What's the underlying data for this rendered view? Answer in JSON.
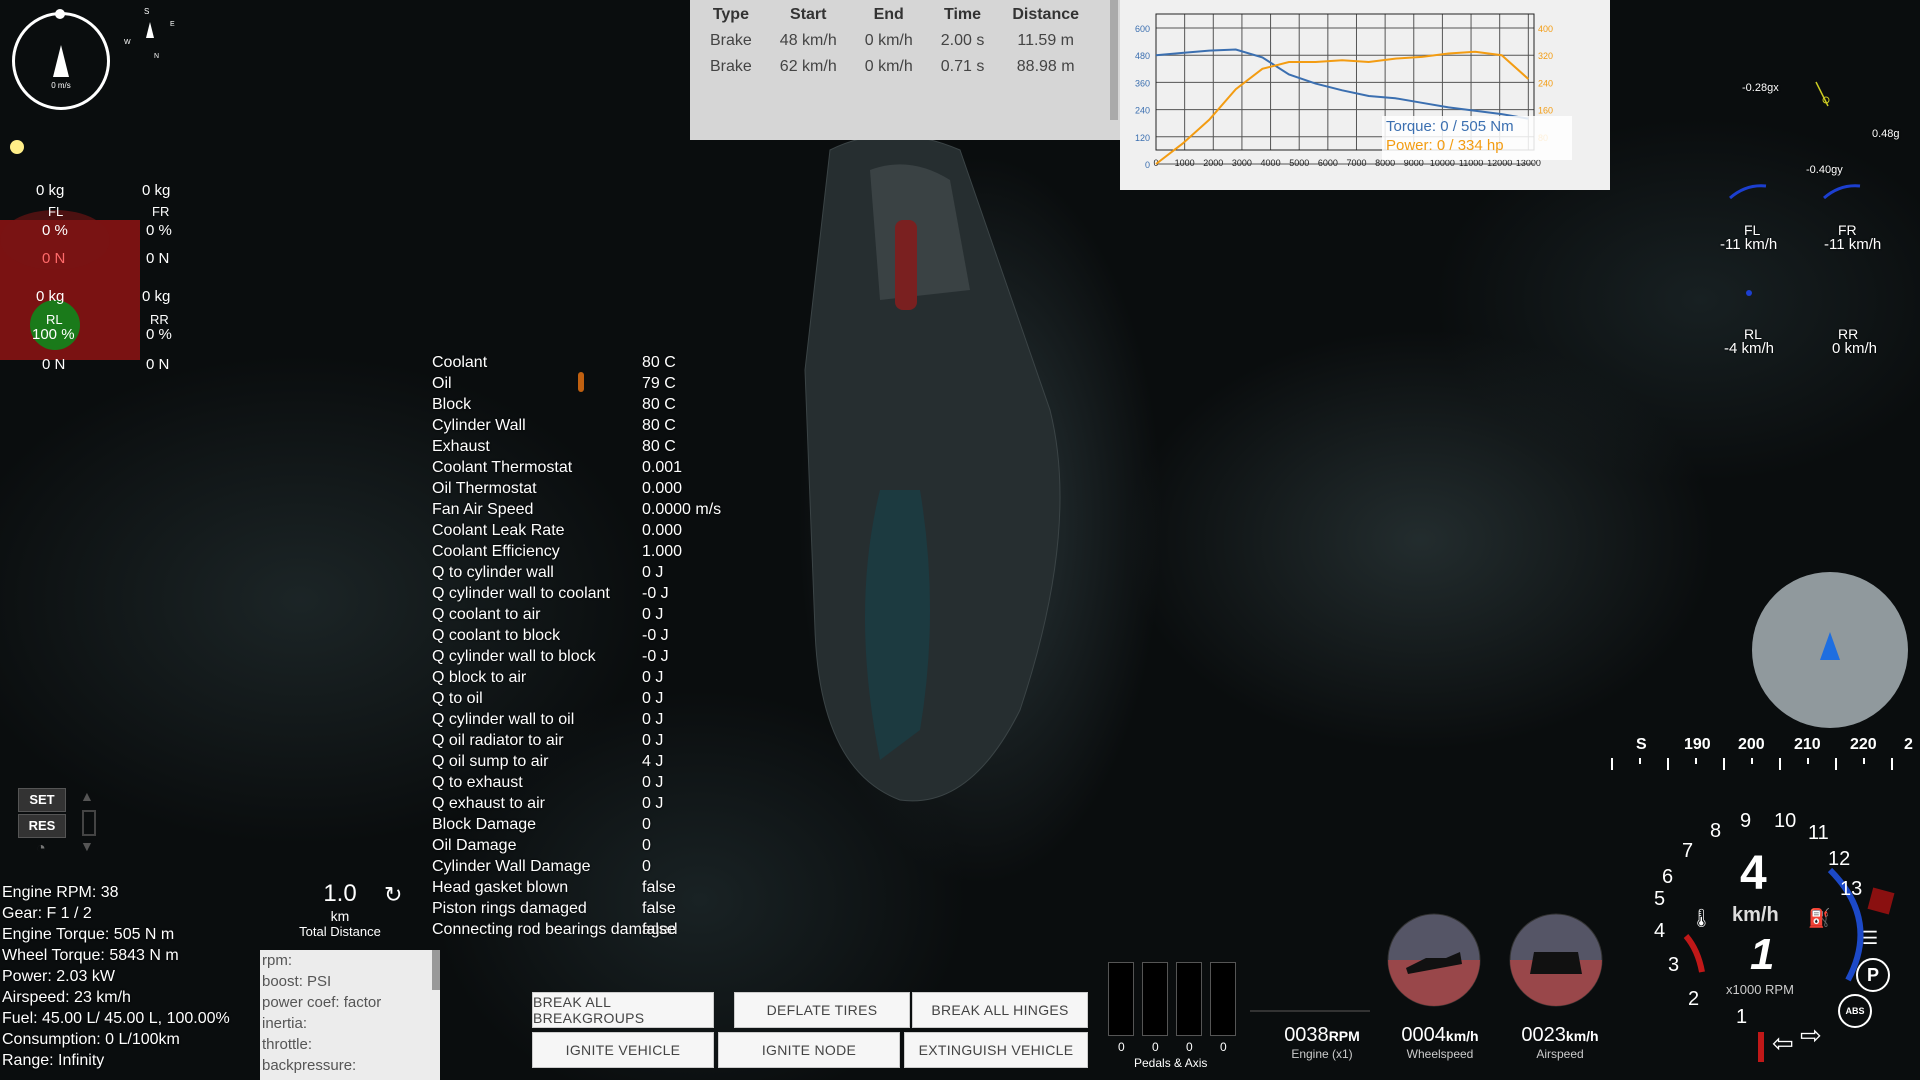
{
  "compass": {
    "speed": "0 m/s",
    "dirs": [
      "S",
      "E",
      "W",
      "N"
    ]
  },
  "tires_left": [
    {
      "mass": "0 kg",
      "label": "FL",
      "pct": "0 %",
      "force": "0 N"
    },
    {
      "mass": "0 kg",
      "label": "FR",
      "pct": "0 %",
      "force": "0 N"
    },
    {
      "mass": "0 kg",
      "label": "RL",
      "pct": "100 %",
      "force": "0 N"
    },
    {
      "mass": "0 kg",
      "label": "RR",
      "pct": "0 %",
      "force": "0 N"
    }
  ],
  "dyno_table": {
    "headers": [
      "Type",
      "Start",
      "End",
      "Time",
      "Distance"
    ],
    "rows": [
      [
        "Brake",
        "48 km/h",
        "0 km/h",
        "2.00 s",
        "11.59 m"
      ],
      [
        "Brake",
        "62 km/h",
        "0 km/h",
        "0.71 s",
        "88.98 m"
      ]
    ]
  },
  "chart_data": {
    "type": "line",
    "x": [
      0,
      1000,
      2000,
      3000,
      4000,
      5000,
      6000,
      7000,
      8000,
      9000,
      10000,
      11000,
      12000,
      13000
    ],
    "xticks": [
      "0",
      "1000",
      "2000",
      "3000",
      "4000",
      "5000",
      "6000",
      "7000",
      "8000",
      "9000",
      "10000",
      "11000",
      "12000",
      "13000"
    ],
    "yleft_ticks": [
      "0",
      "120",
      "240",
      "360",
      "480",
      "600"
    ],
    "yright_ticks": [
      "80",
      "160",
      "240",
      "320",
      "400"
    ],
    "ylim_left": [
      0,
      600
    ],
    "ylim_right": [
      0,
      400
    ],
    "series": [
      {
        "name": "Torque",
        "axis": "left",
        "color": "#3b6fb0",
        "values": [
          480,
          490,
          500,
          505,
          470,
          395,
          355,
          325,
          300,
          290,
          270,
          250,
          235,
          220,
          200
        ]
      },
      {
        "name": "Power",
        "axis": "right",
        "color": "#f39c12",
        "values": [
          0,
          60,
          130,
          220,
          280,
          300,
          300,
          305,
          300,
          310,
          315,
          325,
          330,
          320,
          250
        ]
      }
    ],
    "legend": [
      {
        "label": "Torque: 0 / 505 Nm",
        "color": "#3b6fb0"
      },
      {
        "label": "Power: 0 / 334 hp",
        "color": "#f39c12"
      }
    ],
    "legend_position": "bottom-right"
  },
  "thermo": [
    [
      "Coolant",
      "80 C"
    ],
    [
      "Oil",
      "79 C"
    ],
    [
      "Block",
      "80 C"
    ],
    [
      "Cylinder Wall",
      "80 C"
    ],
    [
      "Exhaust",
      "80 C"
    ],
    [
      "Coolant Thermostat",
      "0.001"
    ],
    [
      "Oil Thermostat",
      "0.000"
    ],
    [
      "Fan Air Speed",
      "0.0000 m/s"
    ],
    [
      "Coolant Leak Rate",
      "0.000"
    ],
    [
      "Coolant Efficiency",
      "1.000"
    ],
    [
      "Q to cylinder wall",
      "0 J"
    ],
    [
      "Q cylinder wall to coolant",
      "-0 J"
    ],
    [
      "Q coolant to air",
      "0 J"
    ],
    [
      "Q coolant to block",
      "-0 J"
    ],
    [
      "Q cylinder wall to block",
      "-0 J"
    ],
    [
      "Q block to air",
      "0 J"
    ],
    [
      "Q to oil",
      "0 J"
    ],
    [
      "Q cylinder wall to oil",
      "0 J"
    ],
    [
      "Q oil radiator to air",
      "0 J"
    ],
    [
      "Q oil sump to air",
      "4 J"
    ],
    [
      "Q to exhaust",
      "0 J"
    ],
    [
      "Q exhaust to air",
      "0 J"
    ],
    [
      "Block Damage",
      "0"
    ],
    [
      "Oil Damage",
      "0"
    ],
    [
      "Cylinder Wall Damage",
      "0"
    ],
    [
      "Head gasket blown",
      "false"
    ],
    [
      "Piston rings damaged",
      "false"
    ],
    [
      "Connecting rod bearings damaged",
      "false"
    ]
  ],
  "gforce": {
    "x": "-0.28gx",
    "y": "-0.40gy",
    "z": "0.48g"
  },
  "wheel_speeds": [
    {
      "label": "FL",
      "value": "-11 km/h"
    },
    {
      "label": "FR",
      "value": "-11 km/h"
    },
    {
      "label": "RL",
      "value": "-4 km/h"
    },
    {
      "label": "RR",
      "value": "0 km/h"
    }
  ],
  "cruise": {
    "set": "SET",
    "res": "RES"
  },
  "stats": [
    "Engine RPM: 38",
    "Gear: F 1 / 2",
    "Engine Torque: 505 N m",
    "Wheel Torque: 5843 N m",
    "Power: 2.03 kW",
    "Airspeed: 23 km/h",
    "Fuel: 45.00 L/ 45.00 L, 100.00%",
    "Consumption: 0 L/100km",
    "Range: Infinity"
  ],
  "trip": {
    "value": "1.0",
    "unit": "km",
    "label": "Total Distance"
  },
  "turbo": [
    "rpm:",
    "boost: PSI",
    "power coef: factor",
    "inertia:",
    "throttle:",
    "backpressure:"
  ],
  "buttons": {
    "break_breakgroups": "BREAK ALL BREAKGROUPS",
    "deflate": "DEFLATE TIRES",
    "break_hinges": "BREAK ALL HINGES",
    "ignite_vehicle": "IGNITE VEHICLE",
    "ignite_node": "IGNITE NODE",
    "extinguish": "EXTINGUISH VEHICLE"
  },
  "pedals": {
    "values": [
      "0",
      "0",
      "0",
      "0"
    ],
    "label": "Pedals & Axis"
  },
  "digital": [
    {
      "value": "0038",
      "unit": "RPM",
      "label": "Engine (x1)"
    },
    {
      "value": "0004",
      "unit": "km/h",
      "label": "Wheelspeed"
    },
    {
      "value": "0023",
      "unit": "km/h",
      "label": "Airspeed"
    }
  ],
  "heading_tape": [
    "S",
    "190",
    "200",
    "210",
    "220",
    "2"
  ],
  "gauge": {
    "gear": "4",
    "unit": "km/h",
    "rpm_label": "x1000 RPM",
    "speed": "1",
    "abs": "ABS",
    "park": "P",
    "ticks": [
      "1",
      "2",
      "3",
      "4",
      "5",
      "6",
      "7",
      "8",
      "9",
      "10",
      "11",
      "12",
      "13"
    ]
  }
}
